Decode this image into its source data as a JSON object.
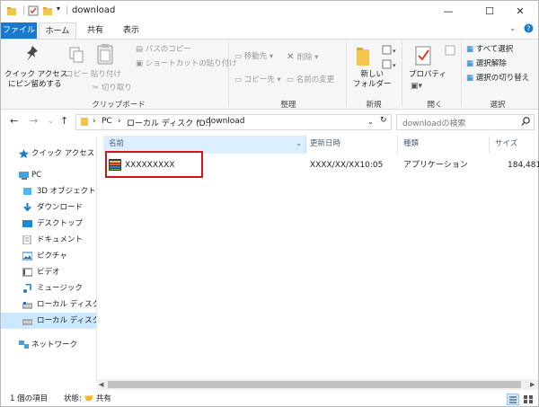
{
  "window": {
    "title": "download",
    "minimize": "—",
    "maximize": "☐",
    "close": "✕"
  },
  "ribbon_tabs": [
    {
      "label": "ファイル"
    },
    {
      "label": "ホーム"
    },
    {
      "label": "共有"
    },
    {
      "label": "表示"
    }
  ],
  "ribbon": {
    "pin_quick_access": [
      "クイック アクセス",
      "にピン留めする"
    ],
    "copy": "コピー",
    "paste": "貼り付け",
    "cut": "切り取り",
    "copy_path": "パスのコピー",
    "paste_shortcut": "ショートカットの貼り付け",
    "group_clipboard": "クリップボード",
    "move_to": "移動先 ▾",
    "copy_to": "コピー先 ▾",
    "delete": "削除 ▾",
    "rename": "名前の変更",
    "group_organize": "整理",
    "new_folder": [
      "新しい",
      "フォルダー"
    ],
    "group_new": "新規",
    "properties": "プロパティ",
    "group_open": "開く",
    "select_all": "すべて選択",
    "select_none": "選択解除",
    "invert_selection": "選択の切り替え",
    "group_select": "選択"
  },
  "address": {
    "crumbs": [
      "PC",
      "ローカル ディスク (D:)",
      "download"
    ],
    "search_placeholder": "downloadの検索"
  },
  "nav_pane": [
    {
      "label": "クイック アクセス",
      "icon": "star-icon"
    },
    {
      "label": "PC",
      "icon": "pc-icon"
    },
    {
      "label": "3D オブジェクト",
      "icon": "3d-objects-icon"
    },
    {
      "label": "ダウンロード",
      "icon": "download-icon"
    },
    {
      "label": "デスクトップ",
      "icon": "desktop-icon"
    },
    {
      "label": "ドキュメント",
      "icon": "documents-icon"
    },
    {
      "label": "ピクチャ",
      "icon": "pictures-icon"
    },
    {
      "label": "ビデオ",
      "icon": "videos-icon"
    },
    {
      "label": "ミュージック",
      "icon": "music-icon"
    },
    {
      "label": "ローカル ディスク (C",
      "icon": "drive-icon"
    },
    {
      "label": "ローカル ディスク (D",
      "icon": "drive-icon"
    },
    {
      "label": "ネットワーク",
      "icon": "network-icon"
    }
  ],
  "columns": [
    {
      "label": "名前"
    },
    {
      "label": "更新日時"
    },
    {
      "label": "種類"
    },
    {
      "label": "サイズ"
    }
  ],
  "files": [
    {
      "name": "XXXXXXXXX",
      "modified": "XXXX/XX/XX10:05",
      "type": "アプリケーション",
      "size": "184,481"
    }
  ],
  "status": {
    "count": "1 個の項目",
    "state": "状態: 🤝 共有"
  },
  "colors": {
    "accent": "#1979ca",
    "selection": "#cce8ff",
    "highlight_box": "#d51313"
  }
}
